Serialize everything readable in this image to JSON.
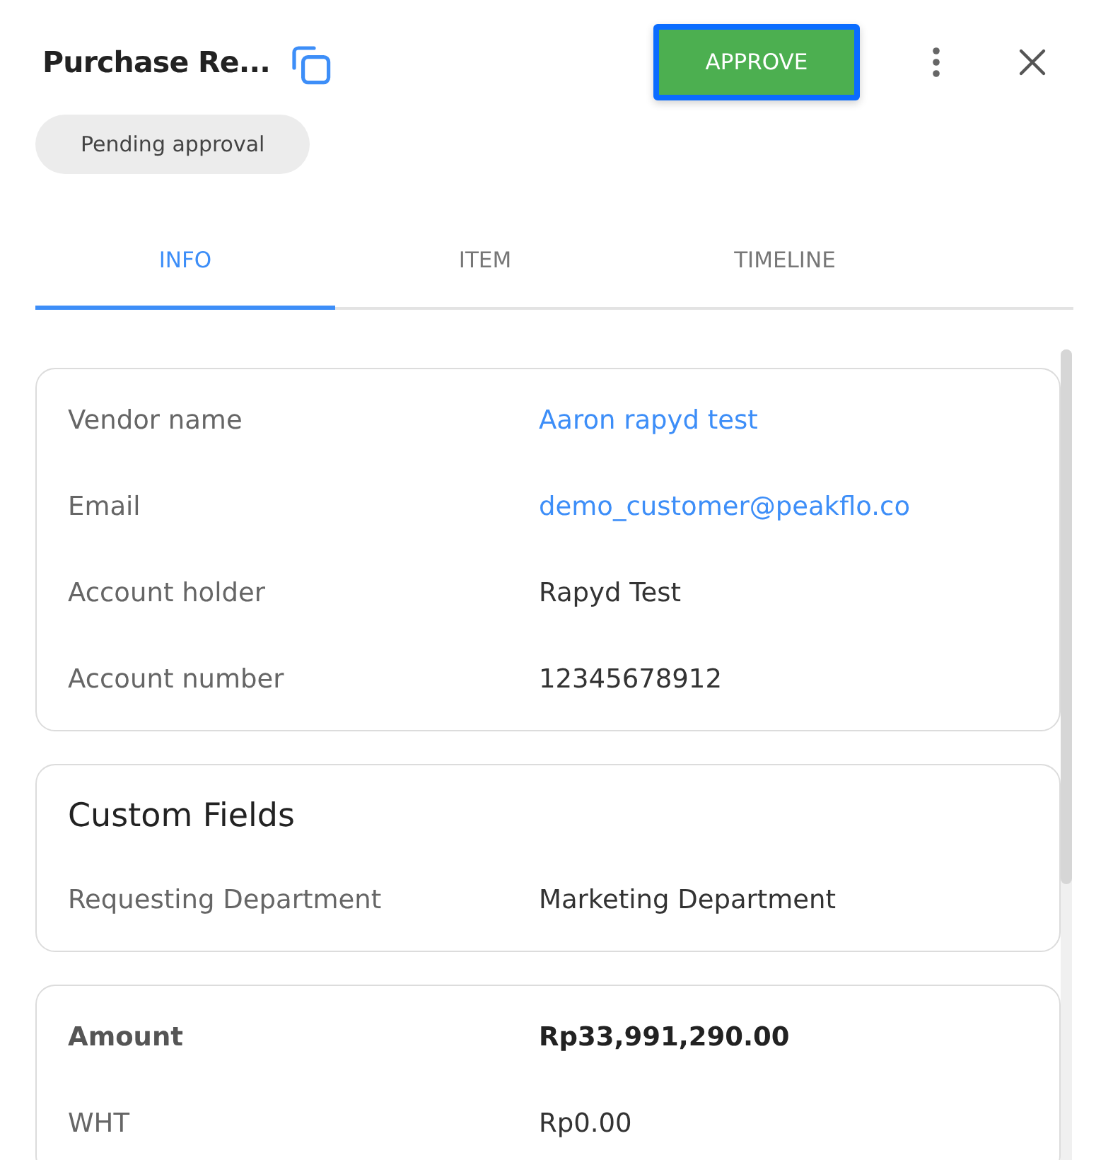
{
  "header": {
    "title": "Purchase Re...",
    "status": "Pending approval",
    "approve_button": {
      "label": "APPROVE",
      "focused": true
    }
  },
  "tabs": [
    {
      "label": "INFO",
      "selected": true
    },
    {
      "label": "ITEM",
      "selected": false
    },
    {
      "label": "TIMELINE",
      "selected": false
    }
  ],
  "sections": [
    {
      "rows": [
        {
          "label": "Vendor name",
          "value": "Aaron rapyd test",
          "kind": "link"
        },
        {
          "label": "Email",
          "value": "demo_customer@peakflo.co",
          "kind": "link"
        },
        {
          "label": "Account holder",
          "value": "Rapyd Test",
          "kind": "text"
        },
        {
          "label": "Account number",
          "value": "12345678912",
          "kind": "text"
        }
      ]
    },
    {
      "title": "Custom Fields",
      "rows": [
        {
          "label": "Requesting Department",
          "value": "Marketing Department",
          "kind": "text"
        }
      ]
    },
    {
      "rows": [
        {
          "label": "Amount",
          "value": "Rp33,991,290.00",
          "kind": "total"
        },
        {
          "label": "WHT",
          "value": "Rp0.00",
          "kind": "text"
        }
      ]
    }
  ]
}
